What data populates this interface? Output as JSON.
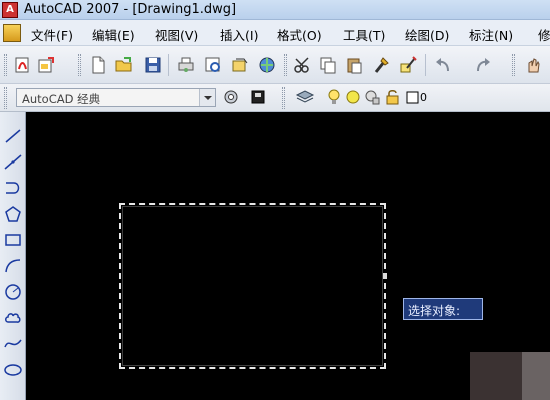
{
  "window": {
    "title": "AutoCAD 2007 - [Drawing1.dwg]"
  },
  "menubar": {
    "items": [
      "文件(F)",
      "编辑(E)",
      "视图(V)",
      "插入(I)",
      "格式(O)",
      "工具(T)",
      "绘图(D)",
      "标注(N)",
      "修"
    ]
  },
  "toolbar2": {
    "workspace_value": "AutoCAD 经典",
    "layer_value": "0"
  },
  "canvas": {
    "tooltip": "选择对象:"
  },
  "icons": {
    "toolbar1": [
      "pdf-export-icon",
      "publish-icon",
      "new-icon",
      "open-icon",
      "save-icon",
      "plot-icon",
      "plot-preview-icon",
      "publish-web-icon",
      "3d-dwf-icon",
      "cut-icon",
      "copy-icon",
      "paste-icon",
      "match-properties-icon",
      "block-editor-icon",
      "undo-icon",
      "redo-icon",
      "pan-icon"
    ],
    "left_toolbar": [
      "line-icon",
      "construction-line-icon",
      "polyline-icon",
      "polygon-icon",
      "rectangle-icon",
      "arc-icon",
      "circle-icon",
      "revision-cloud-icon",
      "spline-icon",
      "ellipse-icon"
    ]
  }
}
